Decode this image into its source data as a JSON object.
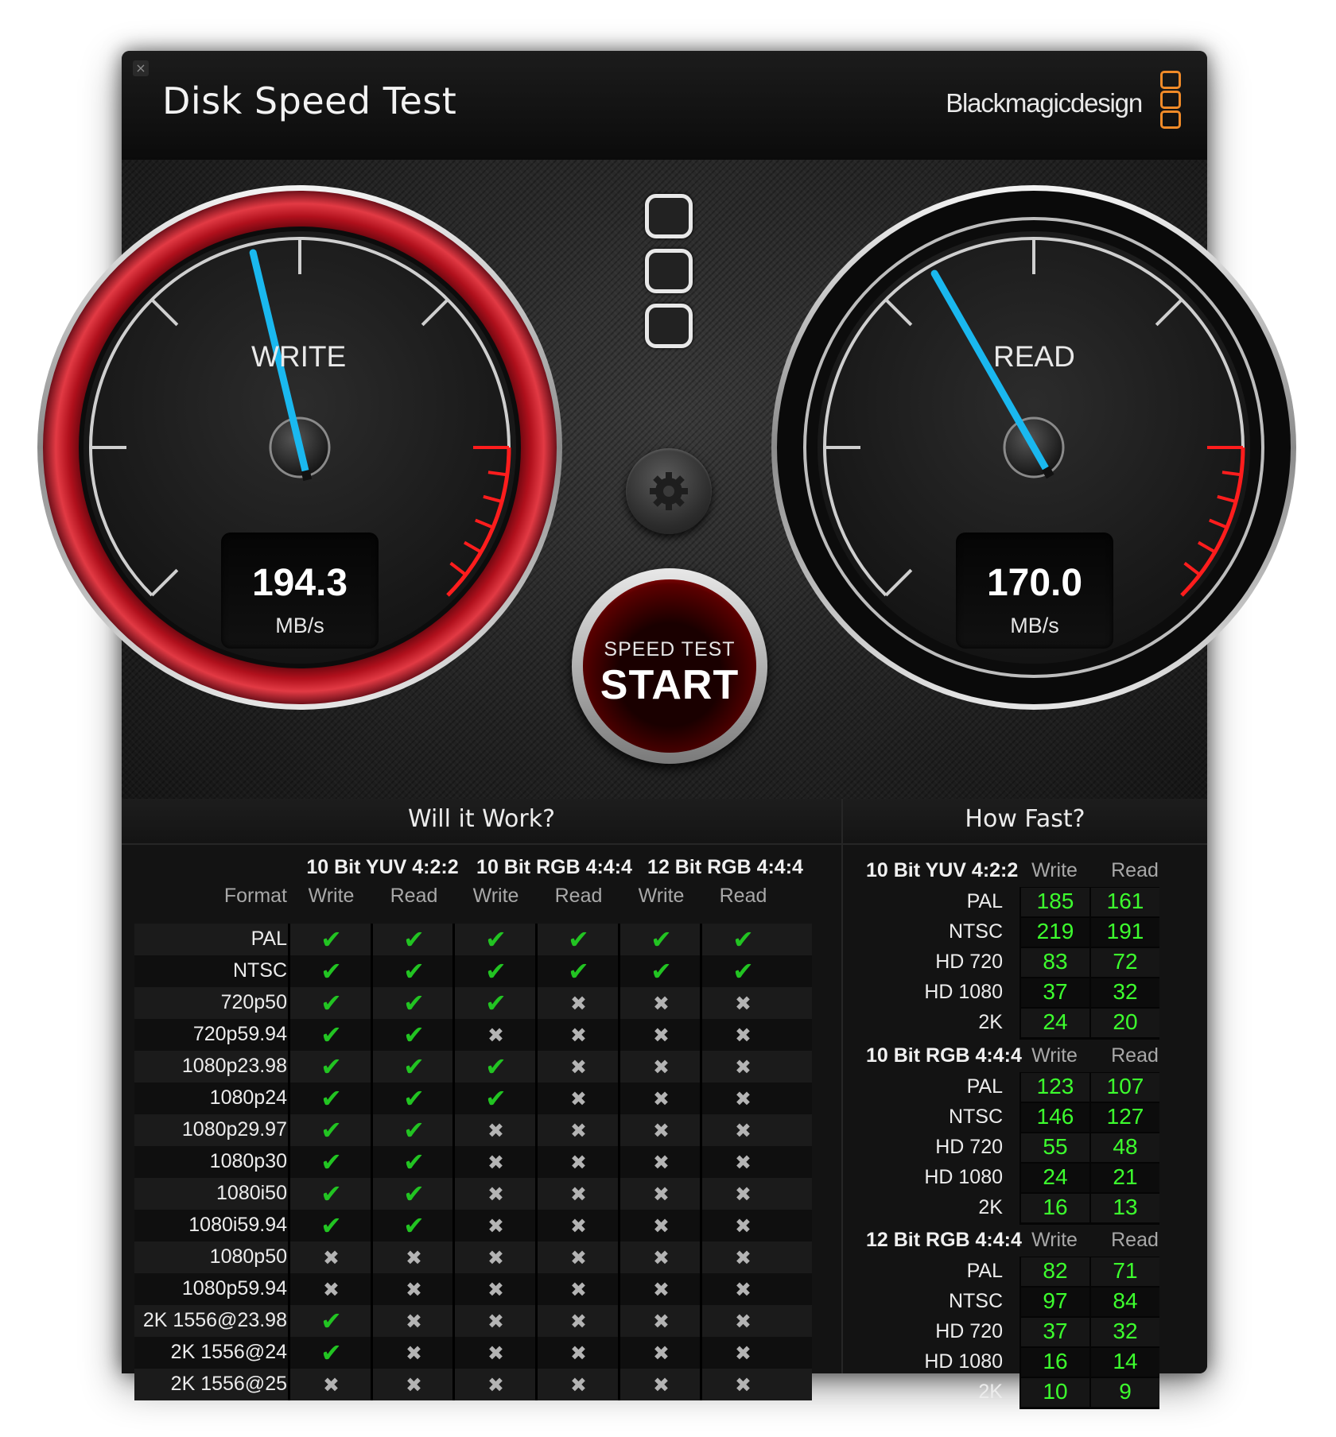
{
  "window": {
    "title": "Disk Speed Test",
    "close_glyph": "×",
    "brand": "Blackmagicdesign"
  },
  "gauges": {
    "write": {
      "label": "WRITE",
      "value": "194.3",
      "unit": "MB/s",
      "needle_fraction": 0.45
    },
    "read": {
      "label": "READ",
      "value": "170.0",
      "unit": "MB/s",
      "needle_fraction": 0.39
    }
  },
  "start_button": {
    "subtitle": "SPEED TEST",
    "label": "START"
  },
  "icons": {
    "close": "close-icon",
    "settings": "gear-icon",
    "logo": "blackmagic-logo-icon"
  },
  "colors": {
    "accent_red": "#e01010",
    "needle": "#1ab8ef",
    "ok_green": "#22c422",
    "value_green": "#3dff2e",
    "logo_orange": "#f08a28"
  },
  "will_it_work": {
    "title": "Will it Work?",
    "format_header": "Format",
    "groups": [
      "10 Bit YUV 4:2:2",
      "10 Bit RGB 4:4:4",
      "12 Bit RGB 4:4:4"
    ],
    "subcols": [
      "Write",
      "Read",
      "Write",
      "Read",
      "Write",
      "Read"
    ],
    "rows": [
      {
        "format": "PAL",
        "results": [
          1,
          1,
          1,
          1,
          1,
          1
        ]
      },
      {
        "format": "NTSC",
        "results": [
          1,
          1,
          1,
          1,
          1,
          1
        ]
      },
      {
        "format": "720p50",
        "results": [
          1,
          1,
          1,
          0,
          0,
          0
        ]
      },
      {
        "format": "720p59.94",
        "results": [
          1,
          1,
          0,
          0,
          0,
          0
        ]
      },
      {
        "format": "1080p23.98",
        "results": [
          1,
          1,
          1,
          0,
          0,
          0
        ]
      },
      {
        "format": "1080p24",
        "results": [
          1,
          1,
          1,
          0,
          0,
          0
        ]
      },
      {
        "format": "1080p29.97",
        "results": [
          1,
          1,
          0,
          0,
          0,
          0
        ]
      },
      {
        "format": "1080p30",
        "results": [
          1,
          1,
          0,
          0,
          0,
          0
        ]
      },
      {
        "format": "1080i50",
        "results": [
          1,
          1,
          0,
          0,
          0,
          0
        ]
      },
      {
        "format": "1080i59.94",
        "results": [
          1,
          1,
          0,
          0,
          0,
          0
        ]
      },
      {
        "format": "1080p50",
        "results": [
          0,
          0,
          0,
          0,
          0,
          0
        ]
      },
      {
        "format": "1080p59.94",
        "results": [
          0,
          0,
          0,
          0,
          0,
          0
        ]
      },
      {
        "format": "2K 1556@23.98",
        "results": [
          1,
          0,
          0,
          0,
          0,
          0
        ]
      },
      {
        "format": "2K 1556@24",
        "results": [
          1,
          0,
          0,
          0,
          0,
          0
        ]
      },
      {
        "format": "2K 1556@25",
        "results": [
          0,
          0,
          0,
          0,
          0,
          0
        ]
      }
    ],
    "check_glyph": "✔",
    "cross_glyph": "✖"
  },
  "how_fast": {
    "title": "How Fast?",
    "write_label": "Write",
    "read_label": "Read",
    "groups": [
      {
        "name": "10 Bit YUV 4:2:2",
        "rows": [
          {
            "format": "PAL",
            "write": "185",
            "read": "161"
          },
          {
            "format": "NTSC",
            "write": "219",
            "read": "191"
          },
          {
            "format": "HD 720",
            "write": "83",
            "read": "72"
          },
          {
            "format": "HD 1080",
            "write": "37",
            "read": "32"
          },
          {
            "format": "2K",
            "write": "24",
            "read": "20"
          }
        ]
      },
      {
        "name": "10 Bit RGB 4:4:4",
        "rows": [
          {
            "format": "PAL",
            "write": "123",
            "read": "107"
          },
          {
            "format": "NTSC",
            "write": "146",
            "read": "127"
          },
          {
            "format": "HD 720",
            "write": "55",
            "read": "48"
          },
          {
            "format": "HD 1080",
            "write": "24",
            "read": "21"
          },
          {
            "format": "2K",
            "write": "16",
            "read": "13"
          }
        ]
      },
      {
        "name": "12 Bit RGB 4:4:4",
        "rows": [
          {
            "format": "PAL",
            "write": "82",
            "read": "71"
          },
          {
            "format": "NTSC",
            "write": "97",
            "read": "84"
          },
          {
            "format": "HD 720",
            "write": "37",
            "read": "32"
          },
          {
            "format": "HD 1080",
            "write": "16",
            "read": "14"
          },
          {
            "format": "2K",
            "write": "10",
            "read": "9"
          }
        ]
      }
    ]
  }
}
